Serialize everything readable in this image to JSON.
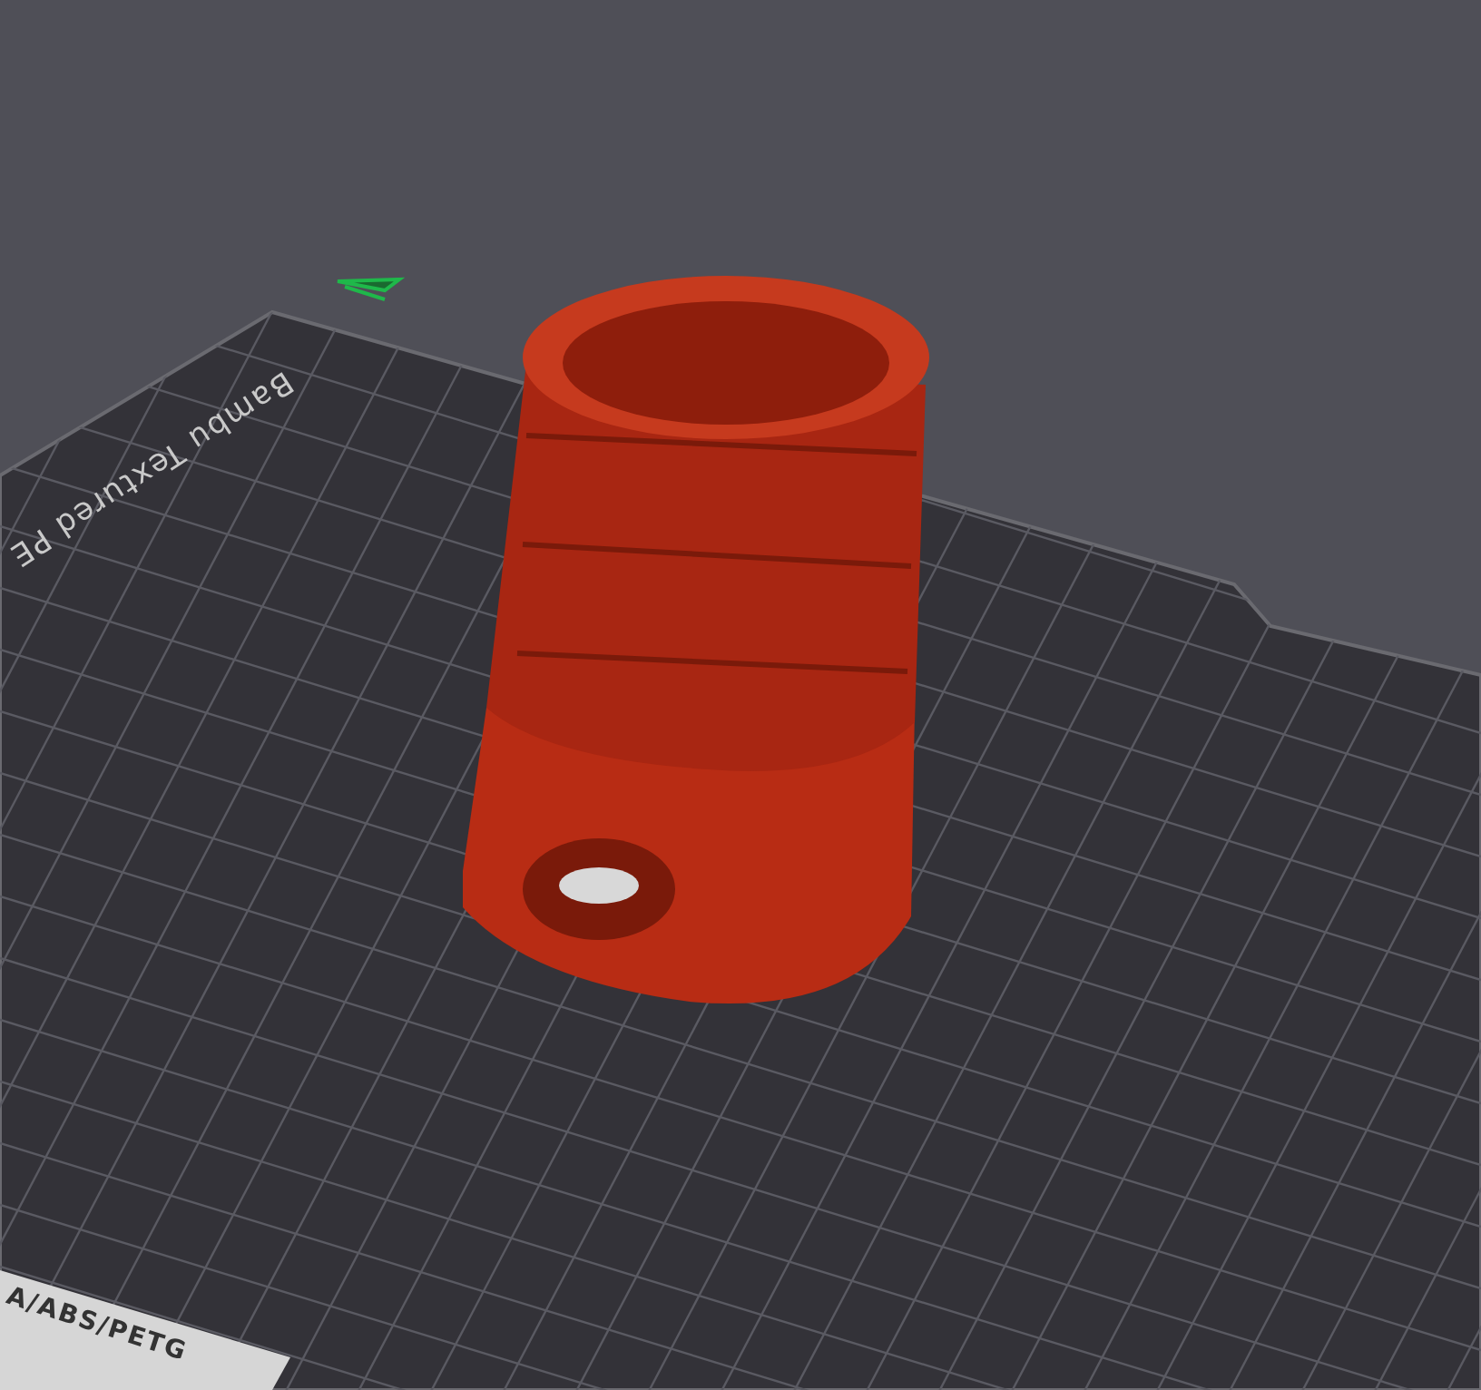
{
  "viewport": {
    "plate_label": "Bambu Textured PE",
    "plate_strip_label": "A/ABS/PETG"
  }
}
